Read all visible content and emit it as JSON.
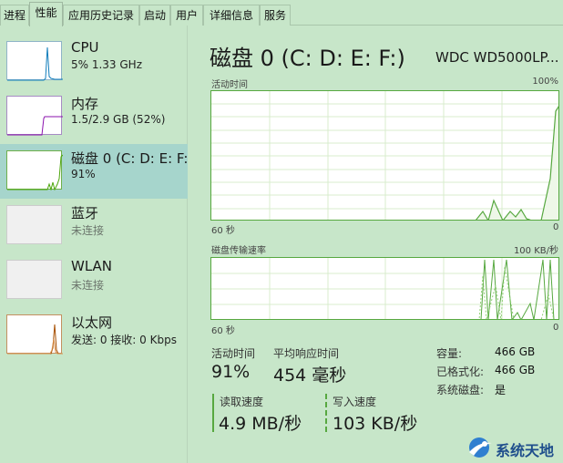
{
  "tabs": [
    {
      "label": "进程",
      "active": false
    },
    {
      "label": "性能",
      "active": true
    },
    {
      "label": "应用历史记录",
      "active": false
    },
    {
      "label": "启动",
      "active": false
    },
    {
      "label": "用户",
      "active": false
    },
    {
      "label": "详细信息",
      "active": false
    },
    {
      "label": "服务",
      "active": false
    }
  ],
  "sidebar": {
    "items": [
      {
        "name": "CPU",
        "sub": "5% 1.33 GHz",
        "color": "#117dbb",
        "selected": false
      },
      {
        "name": "内存",
        "sub": "1.5/2.9 GB (52%)",
        "color": "#8b12ae",
        "selected": false
      },
      {
        "name": "磁盘 0 (C: D: E: F:",
        "sub": "91%",
        "color": "#4da60c",
        "selected": true
      },
      {
        "name": "蓝牙",
        "sub": "未连接",
        "color": "#aaaaaa",
        "selected": false
      },
      {
        "name": "WLAN",
        "sub": "未连接",
        "color": "#aaaaaa",
        "selected": false
      },
      {
        "name": "以太网",
        "sub": "发送: 0 接收: 0 Kbps",
        "color": "#a74f01",
        "selected": false
      }
    ]
  },
  "main": {
    "title": "磁盘 0 (C: D: E: F:)",
    "model": "WDC WD5000LP...",
    "graph1": {
      "label": "活动时间",
      "max_label": "100%",
      "x_left": "60 秒",
      "x_right": "0"
    },
    "graph2": {
      "label": "磁盘传输速率",
      "max_label": "100 KB/秒",
      "x_left": "60 秒",
      "x_right": "0"
    },
    "stats": {
      "active_time_label": "活动时间",
      "active_time_value": "91%",
      "avg_response_label": "平均响应时间",
      "avg_response_value": "454 毫秒",
      "read_speed_label": "读取速度",
      "read_speed_value": "4.9 MB/秒",
      "write_speed_label": "写入速度",
      "write_speed_value": "103 KB/秒"
    },
    "details": {
      "capacity_key": "容量:",
      "capacity_val": "466 GB",
      "formatted_key": "已格式化:",
      "formatted_val": "466 GB",
      "system_disk_key": "系统磁盘:",
      "system_disk_val": "是"
    }
  },
  "watermark": {
    "text": "系统天地",
    "icon": "swoosh-logo-icon",
    "color": "#1f4e8c"
  },
  "colors": {
    "background": "#c7e6c9",
    "selected": "#a6d5cc",
    "disk_green": "#57a840"
  }
}
